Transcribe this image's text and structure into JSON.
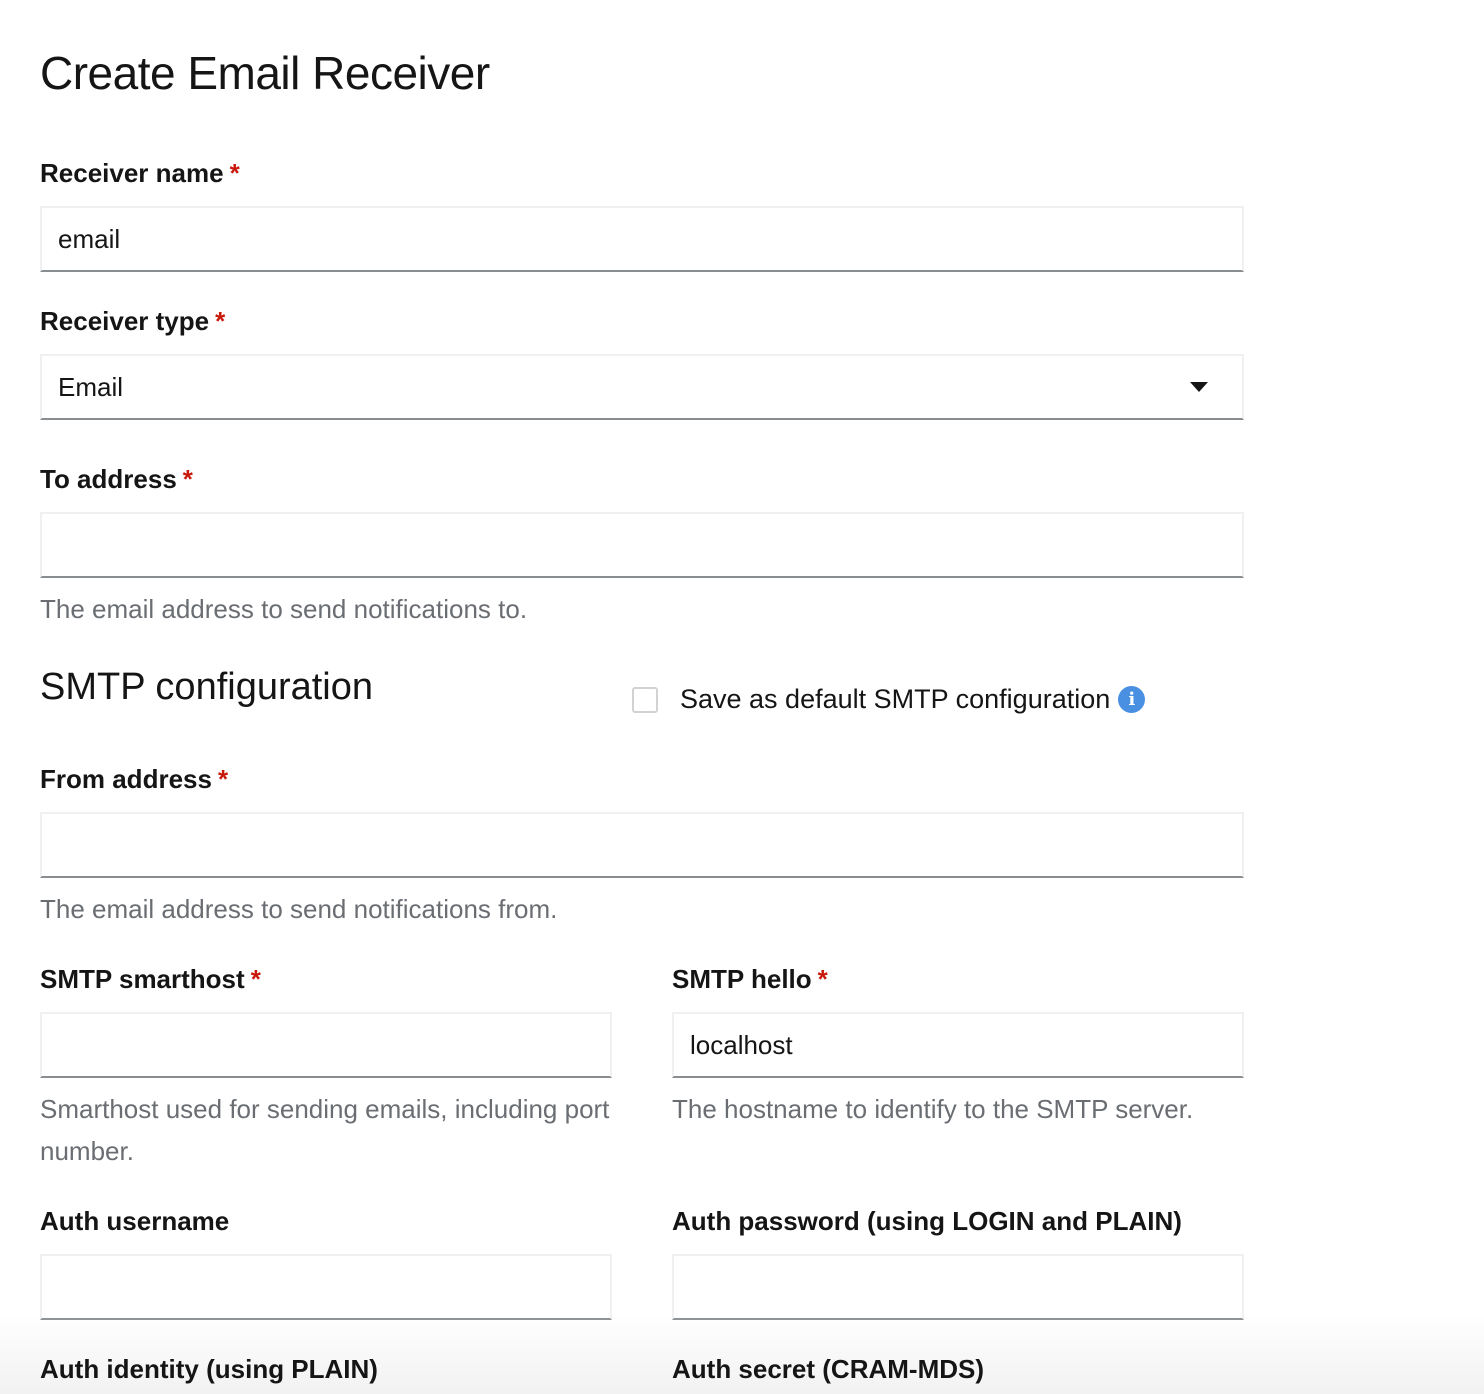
{
  "page": {
    "title": "Create Email Receiver"
  },
  "form": {
    "receiver_name": {
      "label": "Receiver name",
      "required_mark": "*",
      "value": ""
    },
    "receiver_type": {
      "label": "Receiver type",
      "required_mark": "*",
      "selected": "Email"
    },
    "to_address": {
      "label": "To address",
      "required_mark": "*",
      "value": "",
      "help": "The email address to send notifications to."
    }
  },
  "smtp": {
    "title": "SMTP configuration",
    "save_default_label": "Save as default SMTP configuration",
    "save_default_checked": false,
    "from_address": {
      "label": "From address",
      "required_mark": "*",
      "value": "",
      "help": "The email address to send notifications from."
    },
    "smarthost": {
      "label": "SMTP smarthost",
      "required_mark": "*",
      "value": "",
      "help": "Smarthost used for sending emails, including port number."
    },
    "hello": {
      "label": "SMTP hello",
      "required_mark": "*",
      "value": "localhost",
      "help": "The hostname to identify to the SMTP server."
    },
    "auth_username": {
      "label": "Auth username",
      "value": ""
    },
    "auth_password": {
      "label": "Auth password (using LOGIN and PLAIN)",
      "value": ""
    },
    "auth_identity": {
      "label": "Auth identity (using PLAIN)"
    },
    "auth_secret": {
      "label": "Auth secret (CRAM-MDS)"
    }
  },
  "icons": {
    "info": "info-circle-icon",
    "caret": "caret-down-icon"
  },
  "colors": {
    "required": "#c9190b",
    "help_text": "#6a6e73",
    "info_icon": "#4a90e2"
  }
}
